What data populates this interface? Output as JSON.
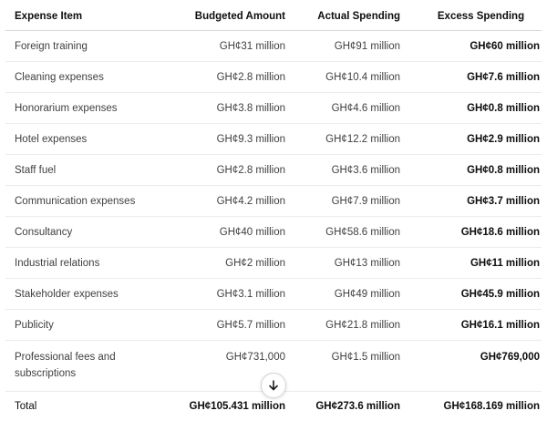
{
  "headers": {
    "item": "Expense Item",
    "budgeted": "Budgeted Amount",
    "actual": "Actual Spending",
    "excess": "Excess Spending"
  },
  "rows": [
    {
      "item": "Foreign training",
      "budgeted": "GH¢31 million",
      "actual": "GH¢91 million",
      "excess": "GH¢60 million"
    },
    {
      "item": "Cleaning expenses",
      "budgeted": "GH¢2.8 million",
      "actual": "GH¢10.4 million",
      "excess": "GH¢7.6 million"
    },
    {
      "item": "Honorarium expenses",
      "budgeted": "GH¢3.8 million",
      "actual": "GH¢4.6 million",
      "excess": "GH¢0.8 million"
    },
    {
      "item": "Hotel expenses",
      "budgeted": "GH¢9.3 million",
      "actual": "GH¢12.2 million",
      "excess": "GH¢2.9 million"
    },
    {
      "item": "Staff fuel",
      "budgeted": "GH¢2.8 million",
      "actual": "GH¢3.6 million",
      "excess": "GH¢0.8 million"
    },
    {
      "item": "Communication expenses",
      "budgeted": "GH¢4.2 million",
      "actual": "GH¢7.9 million",
      "excess": "GH¢3.7 million"
    },
    {
      "item": "Consultancy",
      "budgeted": "GH¢40 million",
      "actual": "GH¢58.6 million",
      "excess": "GH¢18.6 million"
    },
    {
      "item": "Industrial relations",
      "budgeted": "GH¢2 million",
      "actual": "GH¢13 million",
      "excess": "GH¢11 million"
    },
    {
      "item": "Stakeholder expenses",
      "budgeted": "GH¢3.1 million",
      "actual": "GH¢49 million",
      "excess": "GH¢45.9 million"
    },
    {
      "item": "Publicity",
      "budgeted": "GH¢5.7 million",
      "actual": "GH¢21.8 million",
      "excess": "GH¢16.1 million"
    },
    {
      "item": "Professional fees and subscriptions",
      "budgeted": "GH¢731,000",
      "actual": "GH¢1.5 million",
      "excess": "GH¢769,000"
    }
  ],
  "total": {
    "item": "Total",
    "budgeted": "GH¢105.431 million",
    "actual": "GH¢273.6 million",
    "excess": "GH¢168.169 million"
  },
  "scroll_button": {
    "icon": "arrow-down-icon"
  }
}
